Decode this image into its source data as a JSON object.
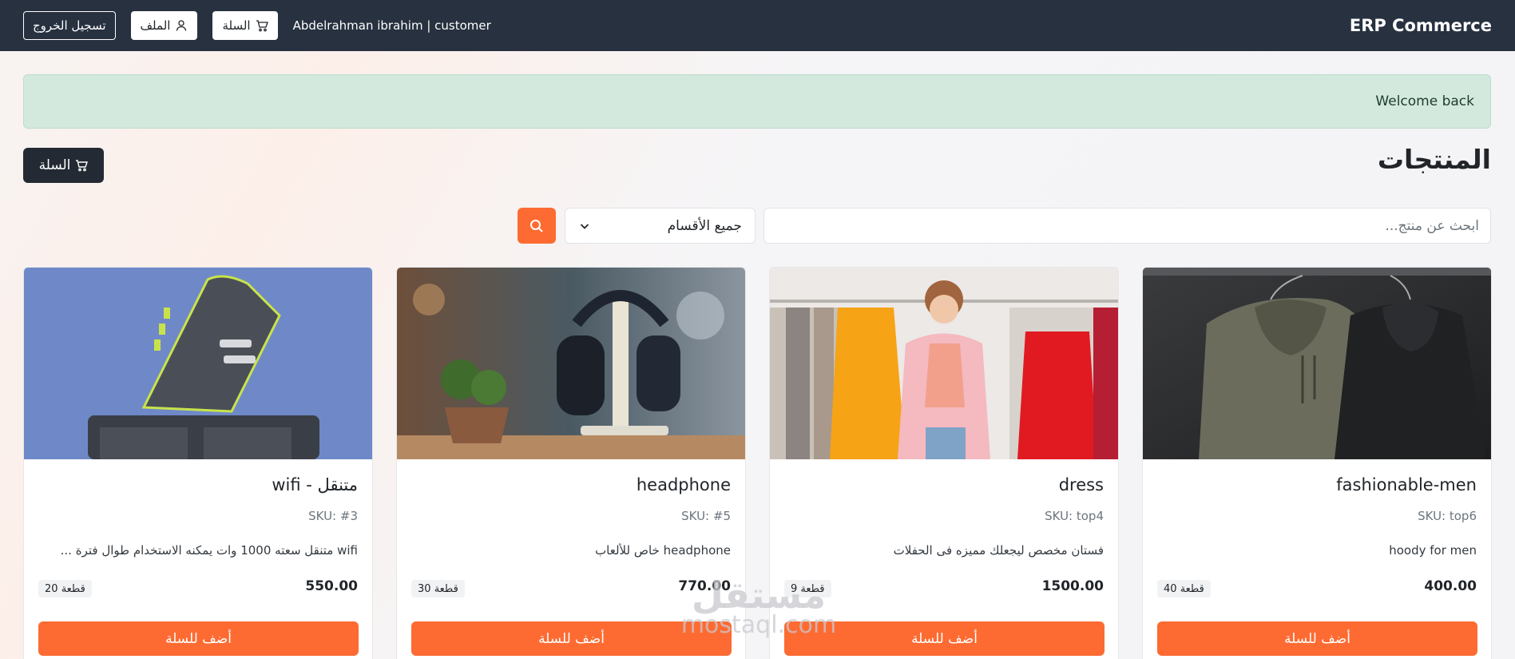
{
  "navbar": {
    "brand": "ERP Commerce",
    "user": "Abdelrahman ibrahim | customer",
    "logout_label": "تسجيل الخروج",
    "profile_label": "الملف",
    "cart_label": "السلة"
  },
  "alert": {
    "message": "Welcome back"
  },
  "page": {
    "title": "المنتجات",
    "cart_button": "السلة"
  },
  "search": {
    "placeholder": "ابحث عن منتج...",
    "category_selected": "جميع الأقسام"
  },
  "products": [
    {
      "name": "fashionable-men",
      "sku": "SKU: top6",
      "description": "hoody for men",
      "price": "400.00",
      "stock": "40 قطعة",
      "add_label": "أضف للسلة"
    },
    {
      "name": "dress",
      "sku": "SKU: top4",
      "description": "فستان مخصص ليجعلك مميزه فى الحفلات",
      "price": "1500.00",
      "stock": "9 قطعة",
      "add_label": "أضف للسلة"
    },
    {
      "name": "headphone",
      "sku": "SKU: #5",
      "description": "headphone خاص للألعاب",
      "price": "770.00",
      "stock": "30 قطعة",
      "add_label": "أضف للسلة"
    },
    {
      "name": "wifi - متنقل",
      "sku": "SKU: #3",
      "description": "wifi متنقل سعته 1000 وات يمكنه الاستخدام طوال فترة ...",
      "price": "550.00",
      "stock": "20 قطعة",
      "add_label": "أضف للسلة"
    }
  ],
  "watermark": {
    "arabic": "مستقل",
    "latin": "mostaql.com"
  },
  "colors": {
    "navbar_bg": "#273140",
    "accent_orange": "#fd6b32",
    "alert_bg": "#d3e9de",
    "dark_button": "#232a33"
  },
  "icons": {
    "cart": "cart-icon",
    "profile": "person-icon",
    "search": "search-icon",
    "chevron": "chevron-down-icon"
  }
}
